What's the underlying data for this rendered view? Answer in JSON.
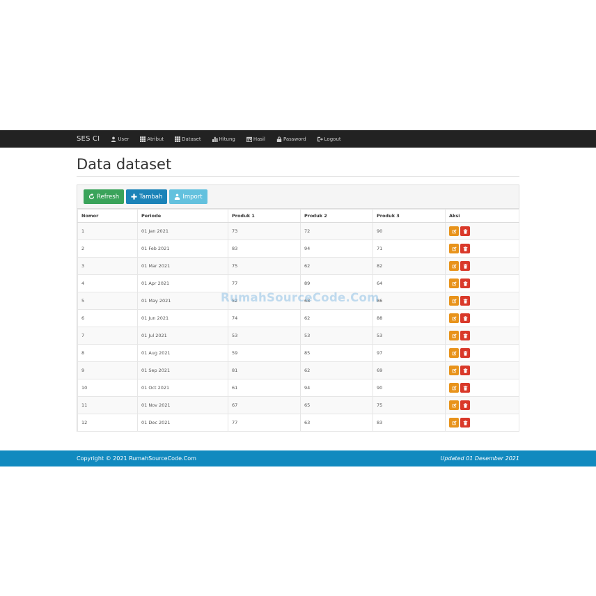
{
  "navbar": {
    "brand": "SES CI",
    "items": [
      {
        "label": "User",
        "icon": "user-icon"
      },
      {
        "label": "Atribut",
        "icon": "grid-icon"
      },
      {
        "label": "Dataset",
        "icon": "grid-icon"
      },
      {
        "label": "Hitung",
        "icon": "bar-chart-icon"
      },
      {
        "label": "Hasil",
        "icon": "calendar-icon"
      },
      {
        "label": "Password",
        "icon": "lock-icon"
      },
      {
        "label": "Logout",
        "icon": "logout-icon"
      }
    ]
  },
  "page": {
    "title": "Data dataset"
  },
  "toolbar": {
    "refresh_label": "Refresh",
    "tambah_label": "Tambah",
    "import_label": "Import"
  },
  "table": {
    "headers": [
      "Nomor",
      "Periode",
      "Produk 1",
      "Produk 2",
      "Produk 3",
      "Aksi"
    ],
    "rows": [
      [
        "1",
        "01 Jan 2021",
        "73",
        "72",
        "90"
      ],
      [
        "2",
        "01 Feb 2021",
        "83",
        "94",
        "71"
      ],
      [
        "3",
        "01 Mar 2021",
        "75",
        "62",
        "82"
      ],
      [
        "4",
        "01 Apr 2021",
        "77",
        "89",
        "64"
      ],
      [
        "5",
        "01 May 2021",
        "52",
        "68",
        "86"
      ],
      [
        "6",
        "01 Jun 2021",
        "74",
        "62",
        "88"
      ],
      [
        "7",
        "01 Jul 2021",
        "53",
        "53",
        "53"
      ],
      [
        "8",
        "01 Aug 2021",
        "59",
        "85",
        "97"
      ],
      [
        "9",
        "01 Sep 2021",
        "81",
        "62",
        "69"
      ],
      [
        "10",
        "01 Oct 2021",
        "61",
        "94",
        "90"
      ],
      [
        "11",
        "01 Nov 2021",
        "67",
        "65",
        "75"
      ],
      [
        "12",
        "01 Dec 2021",
        "77",
        "63",
        "83"
      ]
    ]
  },
  "watermark": "RumahSourceCode.Com",
  "footer": {
    "copyright": "Copyright © 2021 RumahSourceCode.Com",
    "updated": "Updated 01 Desember 2021"
  },
  "colors": {
    "navbar": "#222222",
    "refresh": "#3aa35a",
    "tambah": "#1b83b8",
    "import": "#63c1de",
    "edit": "#e8931b",
    "delete": "#d9392a",
    "footer": "#118abf"
  }
}
